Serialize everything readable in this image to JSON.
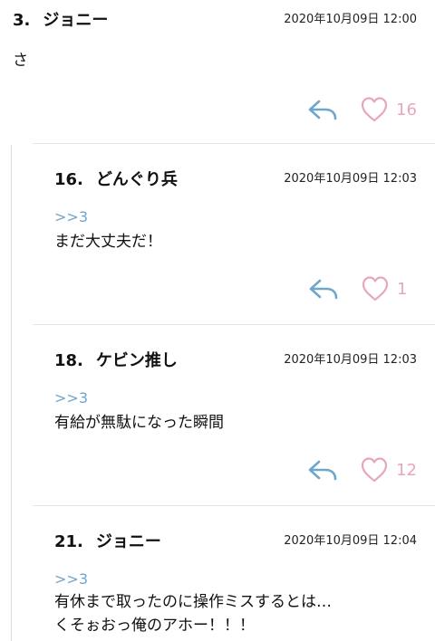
{
  "comments": [
    {
      "number": "3.",
      "author": "ジョニー",
      "date": "2020年10月09日 12:00",
      "reply_to": "",
      "text": "さ",
      "likes": "16"
    },
    {
      "number": "16.",
      "author": "どんぐり兵",
      "date": "2020年10月09日 12:03",
      "reply_to": ">>3",
      "text": "まだ大丈夫だ！",
      "likes": "1"
    },
    {
      "number": "18.",
      "author": "ケビン推し",
      "date": "2020年10月09日 12:03",
      "reply_to": ">>3",
      "text": "有給が無駄になった瞬間",
      "likes": "12"
    },
    {
      "number": "21.",
      "author": "ジョニー",
      "date": "2020年10月09日 12:04",
      "reply_to": ">>3",
      "text": "有休まで取ったのに操作ミスするとは…\nくそぉおっ俺のアホー！！！",
      "likes": ""
    }
  ],
  "colors": {
    "reply_icon": "#6fa6cc",
    "heart_icon": "#e6a7bd",
    "reply_ref": "#6fa6cc"
  }
}
